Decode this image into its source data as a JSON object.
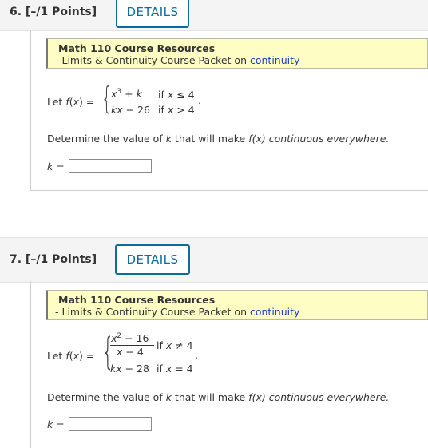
{
  "questions": [
    {
      "header": "6.  [–/1 Points]",
      "details_label": "DETAILS",
      "resources": {
        "title": "Math 110 Course Resources",
        "subtitle_prefix": "- Limits & Continuity Course Packet on ",
        "link": "continuity"
      },
      "lead": "Let f(x) =",
      "case1_expr": "x3 + k",
      "case1_cond": "if x ≤ 4",
      "case2_expr": "kx − 26",
      "case2_cond": "if x > 4",
      "prompt_prefix": "Determine the value of ",
      "prompt_var": "k",
      "prompt_mid": " that will make ",
      "prompt_fx": "f(x)",
      "prompt_suffix": " continuous everywhere.",
      "answer_label": "k =",
      "answer_value": ""
    },
    {
      "header": "7.  [–/1 Points]",
      "details_label": "DETAILS",
      "resources": {
        "title": "Math 110 Course Resources",
        "subtitle_prefix": "- Limits & Continuity Course Packet on ",
        "link": "continuity"
      },
      "lead": "Let f(x) =",
      "case1_num": "x2 − 16",
      "case1_den": "x − 4",
      "case1_cond": "if x ≠ 4",
      "case2_expr": "kx − 28",
      "case2_cond": "if x = 4",
      "prompt_prefix": "Determine the value of ",
      "prompt_var": "k",
      "prompt_mid": " that will make ",
      "prompt_fx": "f(x)",
      "prompt_suffix": " continuous everywhere.",
      "answer_label": "k =",
      "answer_value": ""
    }
  ]
}
